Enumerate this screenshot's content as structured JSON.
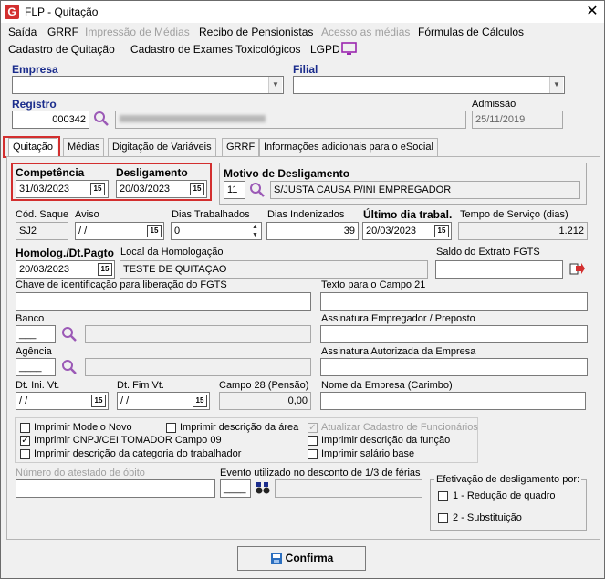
{
  "window": {
    "title": "FLP - Quitação",
    "close_glyph": "✕",
    "icon_letter": "G"
  },
  "menu": {
    "row1": [
      {
        "label": "Saída",
        "enabled": true
      },
      {
        "label": "GRRF",
        "enabled": true
      },
      {
        "label": "Impressão de Médias",
        "enabled": false
      },
      {
        "label": "Recibo de Pensionistas",
        "enabled": true
      },
      {
        "label": "Acesso as médias",
        "enabled": false
      },
      {
        "label": "Fórmulas de Cálculos",
        "enabled": true
      }
    ],
    "row2": [
      {
        "label": "Cadastro de Quitação",
        "enabled": true
      },
      {
        "label": "Cadastro de Exames Toxicológicos",
        "enabled": true
      },
      {
        "label": "LGPD",
        "enabled": true
      }
    ]
  },
  "header": {
    "empresa_label": "Empresa",
    "empresa_value": "",
    "filial_label": "Filial",
    "filial_value": "",
    "registro_label": "Registro",
    "registro_value": "000342",
    "nome_value": "",
    "admissao_label": "Admissão",
    "admissao_value": "25/11/2019"
  },
  "tabs": [
    {
      "label": "Quitação",
      "active": true
    },
    {
      "label": "Médias",
      "active": false
    },
    {
      "label": "Digitação de Variáveis",
      "active": false
    },
    {
      "label": "GRRF",
      "active": false
    },
    {
      "label": "Informações adicionais para o eSocial",
      "active": false
    }
  ],
  "quitacao": {
    "competencia_label": "Competência",
    "competencia_value": "31/03/2023",
    "desligamento_label": "Desligamento",
    "desligamento_value": "20/03/2023",
    "motivo_label": "Motivo de Desligamento",
    "motivo_code": "11",
    "motivo_desc": "S/JUSTA CAUSA P/INI EMPREGADOR",
    "cod_saque_label": "Cód. Saque",
    "cod_saque_value": "SJ2",
    "aviso_label": "Aviso",
    "aviso_value": " /  / ",
    "dias_trab_label": "Dias Trabalhados",
    "dias_trab_value": "0",
    "dias_ind_label": "Dias Indenizados",
    "dias_ind_value": "39",
    "ultimo_dia_label": "Último dia trabal.",
    "ultimo_dia_value": "20/03/2023",
    "tempo_servico_label": "Tempo de Serviço (dias)",
    "tempo_servico_value": "1.212",
    "homolog_label": "Homolog./Dt.Pagto",
    "homolog_value": "20/03/2023",
    "local_homolog_label": "Local da Homologação",
    "local_homolog_value": "TESTE DE QUITAÇAO",
    "saldo_fgts_label": "Saldo do Extrato FGTS",
    "saldo_fgts_value": "",
    "chave_fgts_label": "Chave de identificação para liberação do FGTS",
    "chave_fgts_value": "",
    "texto_campo21_label": "Texto para o Campo 21",
    "texto_campo21_value": "",
    "banco_label": "Banco",
    "banco_value": "___",
    "assinatura_emp_label": "Assinatura Empregador / Preposto",
    "assinatura_emp_value": "",
    "agencia_label": "Agência",
    "agencia_value": "____",
    "assinatura_aut_label": "Assinatura Autorizada da Empresa",
    "assinatura_aut_value": "",
    "dt_ini_vt_label": "Dt. Ini. Vt.",
    "dt_ini_vt_value": " /  / ",
    "dt_fim_vt_label": "Dt. Fim Vt.",
    "dt_fim_vt_value": " /  / ",
    "campo28_label": "Campo 28 (Pensão)",
    "campo28_value": "0,00",
    "nome_empresa_label": "Nome da Empresa (Carimbo)",
    "nome_empresa_value": "",
    "checks": {
      "modelo_novo": {
        "label": "Imprimir Modelo Novo",
        "checked": false
      },
      "cnpj": {
        "label": "Imprimir CNPJ/CEI TOMADOR Campo 09",
        "checked": true
      },
      "categoria": {
        "label": "Imprimir descrição da categoria do trabalhador",
        "checked": false
      },
      "area": {
        "label": "Imprimir descrição da área",
        "checked": false
      },
      "atualizar": {
        "label": "Atualizar Cadastro de Funcionários",
        "checked": true
      },
      "funcao": {
        "label": "Imprimir descrição da função",
        "checked": false
      },
      "salario": {
        "label": "Imprimir salário base",
        "checked": false
      }
    },
    "atestado_label": "Número do atestado de óbito",
    "atestado_value": "",
    "evento_label": "Evento utilizado no desconto de 1/3 de férias",
    "evento_value": "____",
    "efetivacao_label": "Efetivação de desligamento por:",
    "efetivacao_opt1": "1 - Redução de quadro",
    "efetivacao_opt2": "2 - Substituição"
  },
  "confirm_label": "Confirma",
  "colors": {
    "accent": "#d32f2f",
    "label_blue": "#1a2c8c",
    "search_icon": "#9b59b6"
  }
}
